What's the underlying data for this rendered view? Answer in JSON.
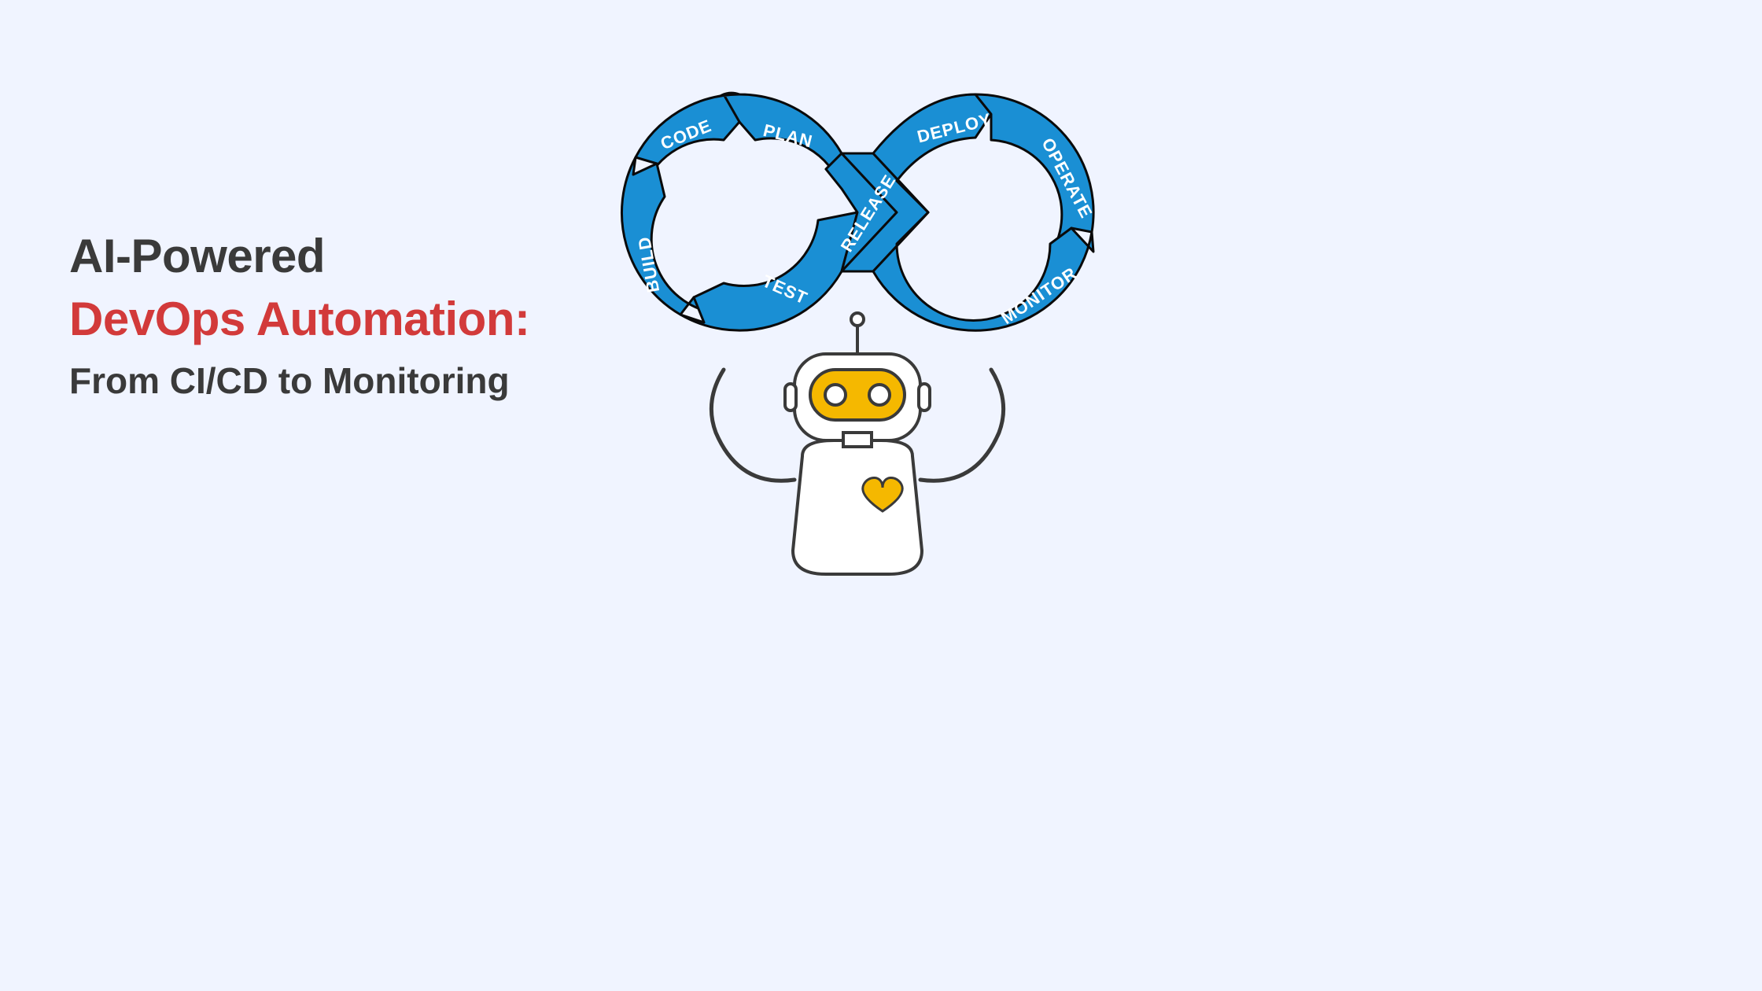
{
  "title": {
    "line1": "AI-Powered",
    "line2": "DevOps Automation:",
    "line3": "From CI/CD to Monitoring"
  },
  "colors": {
    "background": "#f0f4ff",
    "textDark": "#3a3a3a",
    "textAccent": "#d23a3a",
    "loopFill": "#1a8fd4",
    "loopStroke": "#0a0a0a",
    "robotStroke": "#3a3a3a",
    "robotAccent": "#f5b800",
    "robotFill": "#ffffff"
  },
  "devops_loop": {
    "stages": [
      {
        "id": "plan",
        "label": "PLAN"
      },
      {
        "id": "code",
        "label": "CODE"
      },
      {
        "id": "build",
        "label": "BUILD"
      },
      {
        "id": "test",
        "label": "TEST"
      },
      {
        "id": "release",
        "label": "RELEASE"
      },
      {
        "id": "deploy",
        "label": "DEPLOY"
      },
      {
        "id": "operate",
        "label": "OPERATE"
      },
      {
        "id": "monitor",
        "label": "MONITOR"
      }
    ]
  },
  "robot": {
    "icon_label": "heart-icon"
  }
}
